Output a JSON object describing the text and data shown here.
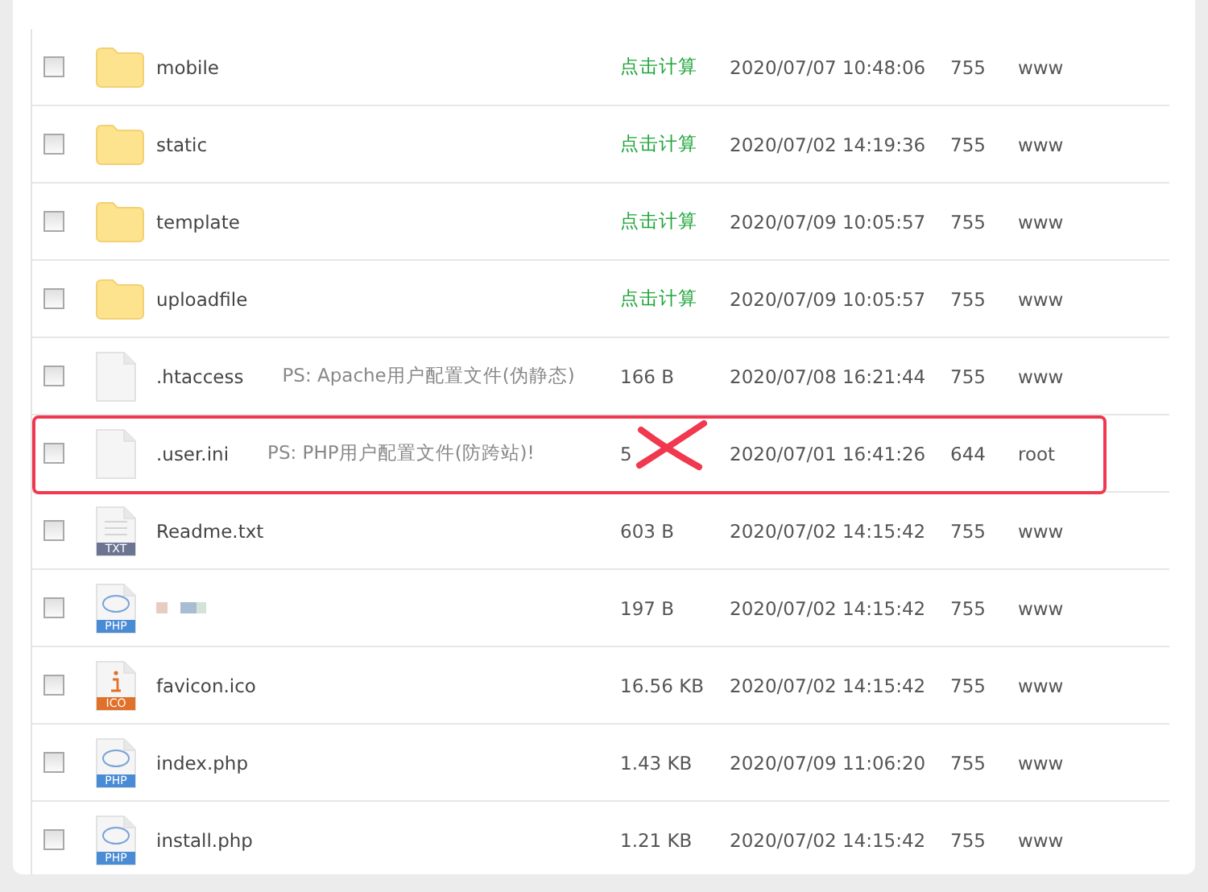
{
  "files": [
    {
      "kind": "folder",
      "name": "mobile",
      "size": "点击计算",
      "modified": "2020/07/07 10:48:06",
      "permissions": "755",
      "owner": "www",
      "checked": false
    },
    {
      "kind": "folder",
      "name": "static",
      "size": "点击计算",
      "modified": "2020/07/02 14:19:36",
      "permissions": "755",
      "owner": "www",
      "checked": false
    },
    {
      "kind": "folder",
      "name": "template",
      "size": "点击计算",
      "modified": "2020/07/09 10:05:57",
      "permissions": "755",
      "owner": "www",
      "checked": false
    },
    {
      "kind": "folder",
      "name": "uploadfile",
      "size": "点击计算",
      "modified": "2020/07/09 10:05:57",
      "permissions": "755",
      "owner": "www",
      "checked": false
    },
    {
      "kind": "file",
      "name": ".htaccess",
      "note": "PS: Apache用户配置文件(伪静态)",
      "size": "166 B",
      "modified": "2020/07/08 16:21:44",
      "permissions": "755",
      "owner": "www",
      "checked": false
    },
    {
      "kind": "file",
      "name": ".user.ini",
      "note": "PS: PHP用户配置文件(防跨站)!",
      "size": "5",
      "modified": "2020/07/01 16:41:26",
      "permissions": "644",
      "owner": "root",
      "checked": false,
      "highlighted": true,
      "size_crossed": true
    },
    {
      "kind": "txt",
      "badge": "TXT",
      "name": "Readme.txt",
      "size": "603 B",
      "modified": "2020/07/02 14:15:42",
      "permissions": "755",
      "owner": "www",
      "checked": false
    },
    {
      "kind": "php",
      "badge": "PHP",
      "name_redacted": true,
      "size": "197 B",
      "modified": "2020/07/02 14:15:42",
      "permissions": "755",
      "owner": "www",
      "checked": false
    },
    {
      "kind": "ico",
      "badge": "ICO",
      "name": "favicon.ico",
      "size": "16.56 KB",
      "modified": "2020/07/02 14:15:42",
      "permissions": "755",
      "owner": "www",
      "checked": false
    },
    {
      "kind": "php",
      "badge": "PHP",
      "name": "index.php",
      "size": "1.43 KB",
      "modified": "2020/07/09 11:06:20",
      "permissions": "755",
      "owner": "www",
      "checked": false
    },
    {
      "kind": "php",
      "badge": "PHP",
      "name": "install.php",
      "size": "1.21 KB",
      "modified": "2020/07/02 14:15:42",
      "permissions": "755",
      "owner": "www",
      "checked": false
    }
  ]
}
